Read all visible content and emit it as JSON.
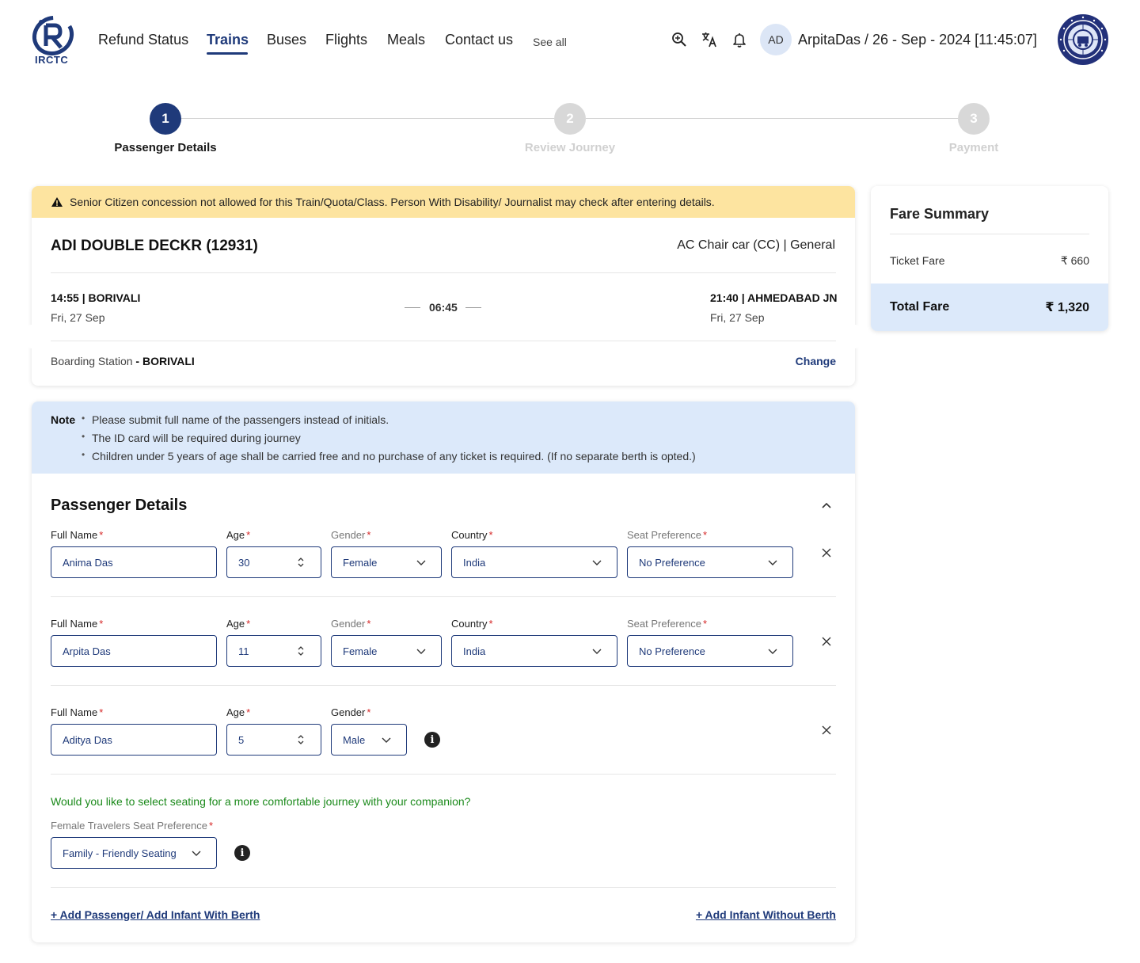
{
  "header": {
    "logo_text": "IRCTC",
    "nav": [
      {
        "label": "Refund Status",
        "active": false
      },
      {
        "label": "Trains",
        "active": true
      },
      {
        "label": "Buses",
        "active": false
      },
      {
        "label": "Flights",
        "active": false
      },
      {
        "label": "Meals",
        "active": false
      },
      {
        "label": "Contact us",
        "active": false
      }
    ],
    "see_all": "See all",
    "icons": [
      "search-zoom-icon",
      "translate-icon",
      "bell-icon"
    ],
    "avatar_initials": "AD",
    "user_info": "ArpitaDas / 26 - Sep - 2024 [11:45:07]"
  },
  "stepper": [
    {
      "number": "1",
      "label": "Passenger Details",
      "active": true
    },
    {
      "number": "2",
      "label": "Review Journey",
      "active": false
    },
    {
      "number": "3",
      "label": "Payment",
      "active": false
    }
  ],
  "warning": "Senior Citizen concession not allowed for this Train/Quota/Class. Person With Disability/ Journalist may check after entering details.",
  "train": {
    "name": "ADI DOUBLE DECKR (12931)",
    "class_quota": "AC Chair car (CC) | General",
    "departure": {
      "time_station": "14:55 | BORIVALI",
      "date": "Fri, 27 Sep"
    },
    "duration": "06:45",
    "arrival": {
      "time_station": "21:40 | AHMEDABAD JN",
      "date": "Fri, 27 Sep"
    },
    "boarding_label": "Boarding Station ",
    "boarding_station": "- BORIVALI",
    "change_label": "Change"
  },
  "note": {
    "title": "Note",
    "items": [
      "Please submit full name of the passengers instead of initials.",
      "The ID card will be required during journey",
      "Children under 5 years of age shall be carried free and no purchase of any ticket is required. (If no separate berth is opted.)"
    ]
  },
  "passenger_section": {
    "title": "Passenger Details",
    "labels": {
      "full_name": "Full Name",
      "age": "Age",
      "gender": "Gender",
      "country": "Country",
      "seat_pref": "Seat Preference",
      "required": "*"
    },
    "passengers": [
      {
        "name": "Anima Das",
        "age": "30",
        "gender": "Female",
        "country": "India",
        "seat_pref": "No Preference"
      },
      {
        "name": "Arpita Das",
        "age": "11",
        "gender": "Female",
        "country": "India",
        "seat_pref": "No Preference"
      },
      {
        "name": "Aditya Das",
        "age": "5",
        "gender": "Male"
      }
    ],
    "info_glyph": "i",
    "companion_question": "Would you like to select seating for a more comfortable journey with your companion?",
    "female_pref_label": "Female Travelers Seat Preference",
    "female_pref_value": "Family - Friendly Seating",
    "add_passenger": "+ Add Passenger/ Add Infant With Berth",
    "add_infant": "+ Add Infant Without Berth"
  },
  "fare": {
    "title": "Fare Summary",
    "ticket_fare_label": "Ticket Fare",
    "ticket_fare_value": "₹ 660",
    "total_label": "Total Fare",
    "total_value": "₹ 1,320"
  },
  "colors": {
    "brand": "#1f3a7a",
    "warning_bg": "#fde4a0",
    "note_bg": "#dce9fa",
    "success_text": "#1b8a1b",
    "required": "#d62828"
  }
}
